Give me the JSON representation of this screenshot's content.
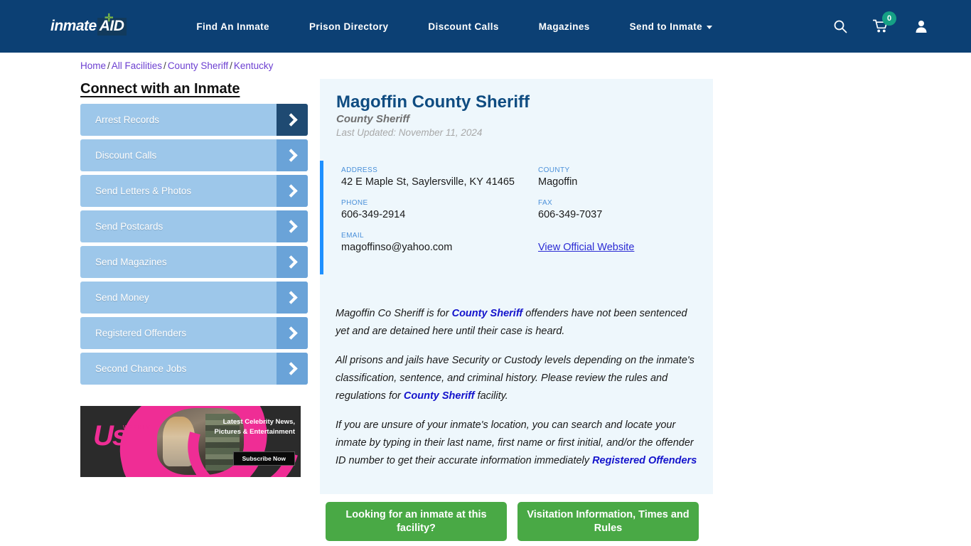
{
  "header": {
    "logo_text": "inmate",
    "logo_badge": "AID",
    "logo_plus": "✛",
    "nav": [
      {
        "label": "Find An Inmate",
        "has_caret": false
      },
      {
        "label": "Prison Directory",
        "has_caret": false
      },
      {
        "label": "Discount Calls",
        "has_caret": false
      },
      {
        "label": "Magazines",
        "has_caret": false
      },
      {
        "label": "Send to Inmate",
        "has_caret": true
      }
    ],
    "cart_count": "0",
    "brand_color": "#0c4074",
    "badge_color": "#16a085"
  },
  "breadcrumb": {
    "items": [
      "Home",
      "All Facilities",
      "County Sheriff",
      "Kentucky"
    ],
    "separator": "/"
  },
  "sidebar": {
    "title": "Connect with an Inmate",
    "items": [
      {
        "label": "Arrest Records",
        "active": true
      },
      {
        "label": "Discount Calls",
        "active": false
      },
      {
        "label": "Send Letters & Photos",
        "active": false
      },
      {
        "label": "Send Postcards",
        "active": false
      },
      {
        "label": "Send Magazines",
        "active": false
      },
      {
        "label": "Send Money",
        "active": false
      },
      {
        "label": "Registered Offenders",
        "active": false
      },
      {
        "label": "Second Chance Jobs",
        "active": false
      }
    ]
  },
  "ad": {
    "logo": "Us",
    "logo_dots": "WEEKLY",
    "text": "Latest Celebrity News, Pictures & Entertainment",
    "cta": "Subscribe Now"
  },
  "facility": {
    "name": "Magoffin County Sheriff",
    "type": "County Sheriff",
    "last_updated": "Last Updated: November 11, 2024",
    "address_label": "ADDRESS",
    "address_value": "42 E Maple St, Saylersville, KY 41465",
    "county_label": "COUNTY",
    "county_value": "Magoffin",
    "phone_label": "PHONE",
    "phone_value": "606-349-2914",
    "fax_label": "FAX",
    "fax_value": "606-349-7037",
    "email_label": "EMAIL",
    "email_value": "magoffinso@yahoo.com",
    "website_link": "View Official Website",
    "accent_color": "#1e90ff"
  },
  "description": {
    "p1_a": "Magoffin Co Sheriff is for ",
    "p1_link": "County Sheriff",
    "p1_b": " offenders have not been sentenced yet and are detained here until their case is heard.",
    "p2_a": "All prisons and jails have Security or Custody levels depending on the inmate's classification, sentence, and criminal history. Please review the rules and regulations for ",
    "p2_link": "County Sheriff",
    "p2_b": " facility.",
    "p3_a": "If you are unsure of your inmate's location, you can search and locate your inmate by typing in their last name, first name or first initial, and/or the offender ID number to get their accurate information immediately ",
    "p3_link": "Registered Offenders"
  },
  "cta": {
    "primary": "Looking for an inmate at this facility?",
    "secondary": "Visitation Information, Times and Rules",
    "color": "#49a945"
  }
}
